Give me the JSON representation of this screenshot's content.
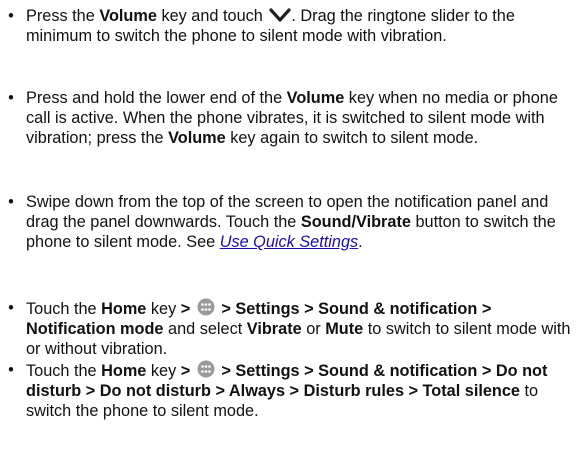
{
  "items": [
    {
      "parts": [
        {
          "t": "Press the "
        },
        {
          "t": "Volume",
          "b": true
        },
        {
          "t": " key and touch "
        },
        {
          "icon": "chevron-down-icon"
        },
        {
          "t": ". Drag the ringtone slider to the minimum to switch the phone to silent mode with vibration."
        }
      ]
    },
    {
      "parts": [
        {
          "t": "Press and hold the lower end of the "
        },
        {
          "t": "Volume",
          "b": true
        },
        {
          "t": " key when no media or phone call is active. When the phone vibrates, it is switched to silent mode with vibration; press the "
        },
        {
          "t": "Volume",
          "b": true
        },
        {
          "t": " key again to switch to silent mode."
        }
      ]
    },
    {
      "parts": [
        {
          "t": "Swipe down from the top of the screen to open the notification panel and drag the panel downwards. Touch the "
        },
        {
          "t": "Sound/Vibrate",
          "b": true
        },
        {
          "t": " button to switch the phone to silent mode. See "
        },
        {
          "t": "Use Quick Settings",
          "link": true
        },
        {
          "t": "."
        }
      ]
    },
    {
      "parts": [
        {
          "t": "Touch the "
        },
        {
          "t": "Home",
          "b": true
        },
        {
          "t": " key "
        },
        {
          "t": ">",
          "b": true
        },
        {
          "t": " "
        },
        {
          "icon": "apps-icon"
        },
        {
          "t": " > Settings > Sound & notification > Notification mode",
          "b": true
        },
        {
          "t": " and select "
        },
        {
          "t": "Vibrate",
          "b": true
        },
        {
          "t": " or "
        },
        {
          "t": "Mute",
          "b": true
        },
        {
          "t": " to switch to silent mode with or without vibration."
        }
      ]
    },
    {
      "parts": [
        {
          "t": "Touch the "
        },
        {
          "t": "Home",
          "b": true
        },
        {
          "t": " key "
        },
        {
          "t": ">",
          "b": true
        },
        {
          "t": " "
        },
        {
          "icon": "apps-icon"
        },
        {
          "t": " > Settings > Sound & notification > Do not disturb > Do not disturb > Always > Disturb rules > Total silence",
          "b": true
        },
        {
          "t": " to switch the phone to silent mode."
        }
      ]
    }
  ],
  "bullet": "•"
}
